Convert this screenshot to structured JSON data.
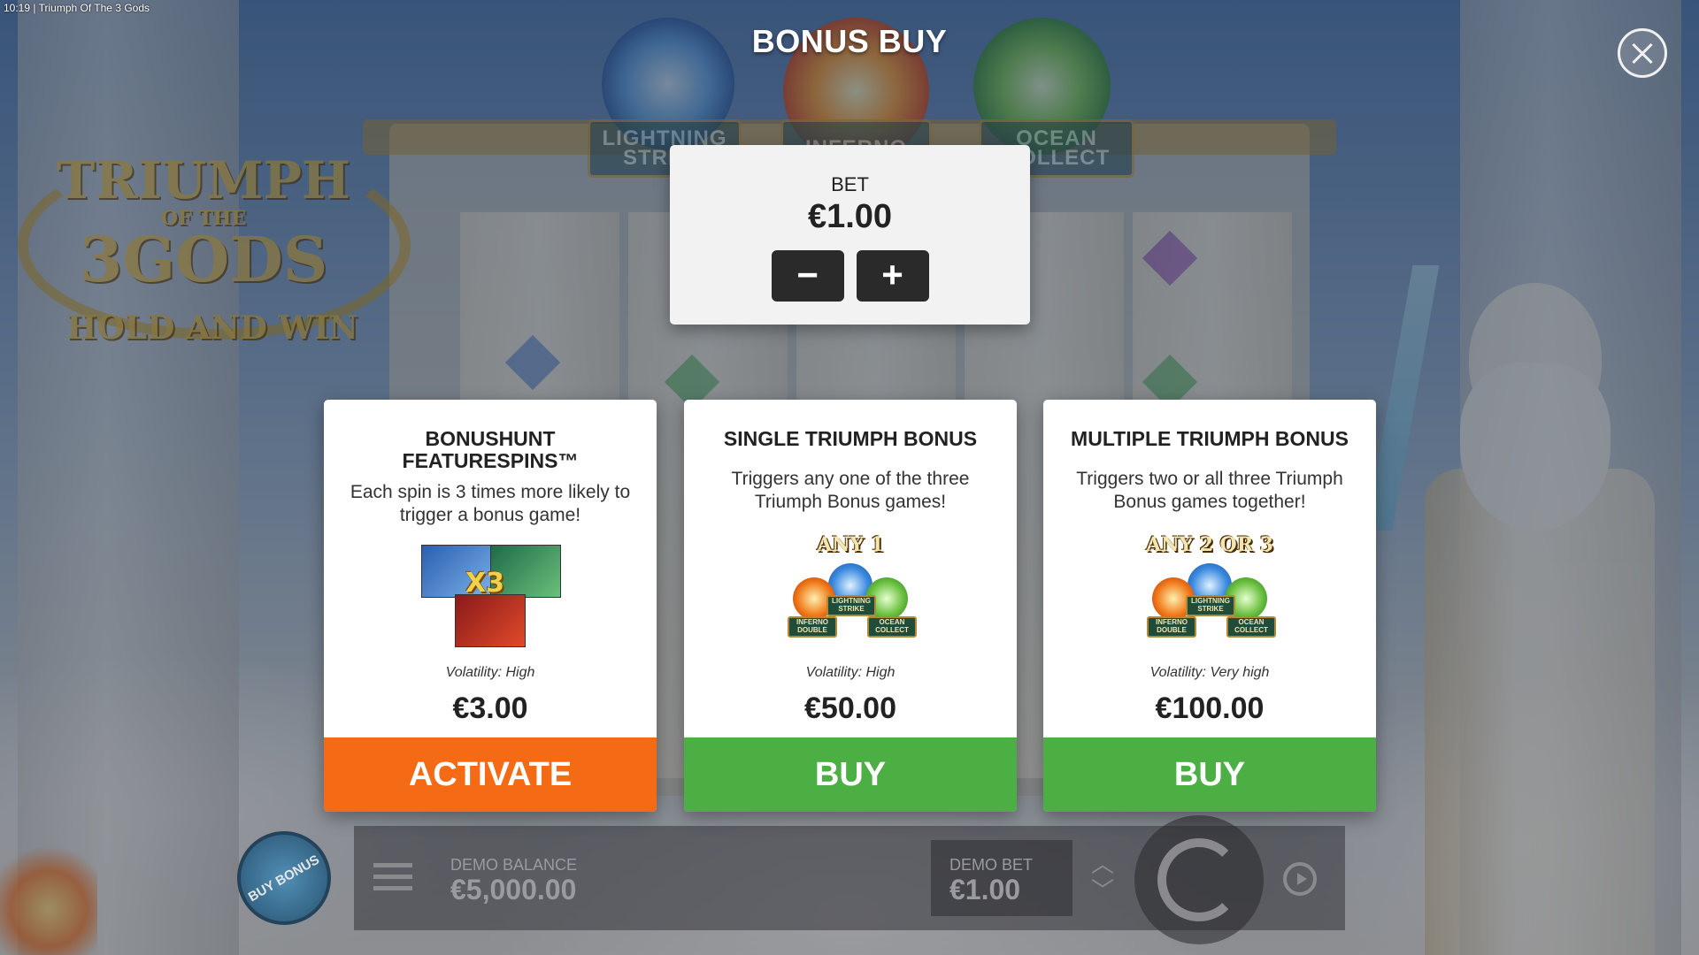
{
  "status_bar": {
    "time": "10:19",
    "title": "Triumph Of The 3 Gods"
  },
  "background": {
    "logo": {
      "line1": "TRIUMPH",
      "line2": "OF THE",
      "line3": "3GODS",
      "tagline": "HOLD AND WIN"
    },
    "plaques": [
      "LIGHTNING STRIKE",
      "INFERNO",
      "OCEAN COLLECT"
    ]
  },
  "modal": {
    "title": "BONUS BUY",
    "close_icon": "close-icon",
    "bet": {
      "label": "BET",
      "value": "€1.00",
      "minus": "−",
      "plus": "+"
    },
    "cards": [
      {
        "title": "BONUSHUNT FEATURESPINS™",
        "description": "Each spin is 3 times more likely to trigger a bonus game!",
        "image_label": "X3",
        "volatility": "Volatility: High",
        "price": "€3.00",
        "button": "ACTIVATE",
        "button_color": "#f56a14"
      },
      {
        "title": "SINGLE TRIUMPH BONUS",
        "description": "Triggers any one of the three Triumph Bonus games!",
        "image_label": "ANY 1",
        "volatility": "Volatility: High",
        "price": "€50.00",
        "button": "BUY",
        "button_color": "#4caf44"
      },
      {
        "title": "MULTIPLE TRIUMPH BONUS",
        "description": "Triggers two or all three Triumph Bonus games together!",
        "image_label": "ANY 2 OR 3",
        "volatility": "Volatility: Very high",
        "price": "€100.00",
        "button": "BUY",
        "button_color": "#4caf44"
      }
    ],
    "mini_tags": {
      "lightning": "LIGHTNING STRIKE",
      "inferno": "INFERNO DOUBLE",
      "ocean": "OCEAN COLLECT"
    }
  },
  "game_bar": {
    "buy_bonus": "BUY BONUS",
    "balance_label": "DEMO BALANCE",
    "balance_value": "€5,000.00",
    "bet_label": "DEMO BET",
    "bet_value": "€1.00"
  }
}
